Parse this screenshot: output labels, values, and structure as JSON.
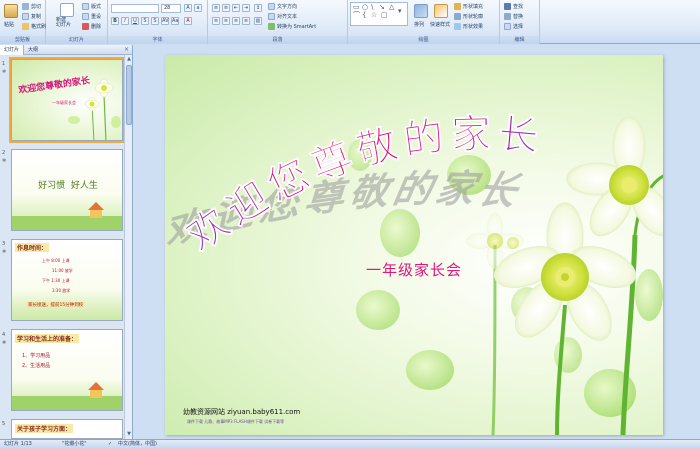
{
  "ribbon": {
    "clipboard": {
      "paste": "粘贴",
      "cut": "剪切",
      "copy": "复制",
      "format_painter": "格式刷",
      "label": "剪贴板"
    },
    "slides": {
      "new_slide": "新建\n幻灯片",
      "layout": "版式",
      "reset": "重设",
      "delete": "删除",
      "label": "幻灯片"
    },
    "font": {
      "font_name": "",
      "font_size": "28",
      "label": "字体"
    },
    "paragraph": {
      "text_direction": "文字方向",
      "align_text": "对齐文本",
      "smartart": "转换为 SmartArt",
      "label": "段落"
    },
    "drawing": {
      "arrange": "排列",
      "quick_styles": "快速样式",
      "shape_fill": "形状填充",
      "shape_outline": "形状轮廓",
      "shape_effects": "形状效果",
      "label": "绘图"
    },
    "editing": {
      "find": "查找",
      "replace": "替换",
      "select": "选择",
      "label": "编辑"
    }
  },
  "panel": {
    "tabs": [
      "幻灯片",
      "大纲"
    ],
    "close": "×"
  },
  "thumbnails": [
    {
      "num": "1",
      "text": "欢迎您尊敬的家长",
      "sub": "一年级家长会"
    },
    {
      "num": "2",
      "text": "好习惯  好人生"
    },
    {
      "num": "3",
      "heading": "作息时间：",
      "lines": [
        "上午 8:00 上课",
        "11:00 放学",
        "下午 1:30 上课",
        "3:30 放学"
      ],
      "footer": "家长接送，提前15分钟到校"
    },
    {
      "num": "4",
      "heading": "学习和生活上的准备：",
      "lines": [
        "1、学习用品",
        "2、生活用品"
      ]
    },
    {
      "num": "5",
      "heading": "关于孩子学习方面："
    }
  ],
  "slide": {
    "title": "欢迎您尊敬的家长",
    "subtitle": "一年级家长会",
    "site": "幼教资源网站  ziyuan.baby611.com",
    "site_sub": "课件下载  儿歌、故事MP3  FLASH课件下载  试卷下载等"
  },
  "status": {
    "slide_info": "幻灯片 1/13",
    "theme": "\"花瓣小花\"",
    "language": "中文(简体，中国)"
  },
  "colors": {
    "title_pink": "#e0177c",
    "title_purple": "#8b2fd6",
    "accent": "#f3a93c"
  }
}
